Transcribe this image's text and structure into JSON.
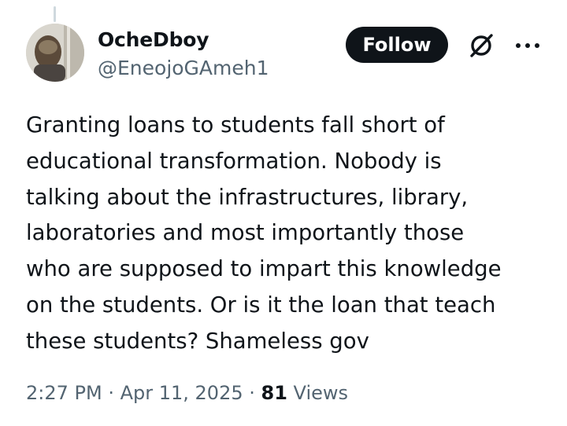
{
  "author": {
    "display_name": "OcheDboy",
    "handle": "@EneojoGAmeh1"
  },
  "actions": {
    "follow_label": "Follow",
    "grok_icon": "grok-icon",
    "more_icon": "more-icon"
  },
  "tweet": {
    "lines": [
      "Granting loans to students fall short of",
      "educational transformation. Nobody is",
      "talking about the infrastructures, library,",
      "laboratories and most importantly those",
      "who are supposed to impart this knowledge",
      "on the students. Or is it the loan that teach",
      "these students? Shameless gov"
    ]
  },
  "meta": {
    "time": "2:27 PM",
    "separator1": " · ",
    "date": "Apr 11, 2025",
    "separator2": " · ",
    "views_count": "81",
    "views_label": " Views"
  },
  "colors": {
    "text_primary": "#0f1419",
    "text_secondary": "#536471",
    "button_bg": "#0f1419",
    "button_text": "#ffffff"
  }
}
